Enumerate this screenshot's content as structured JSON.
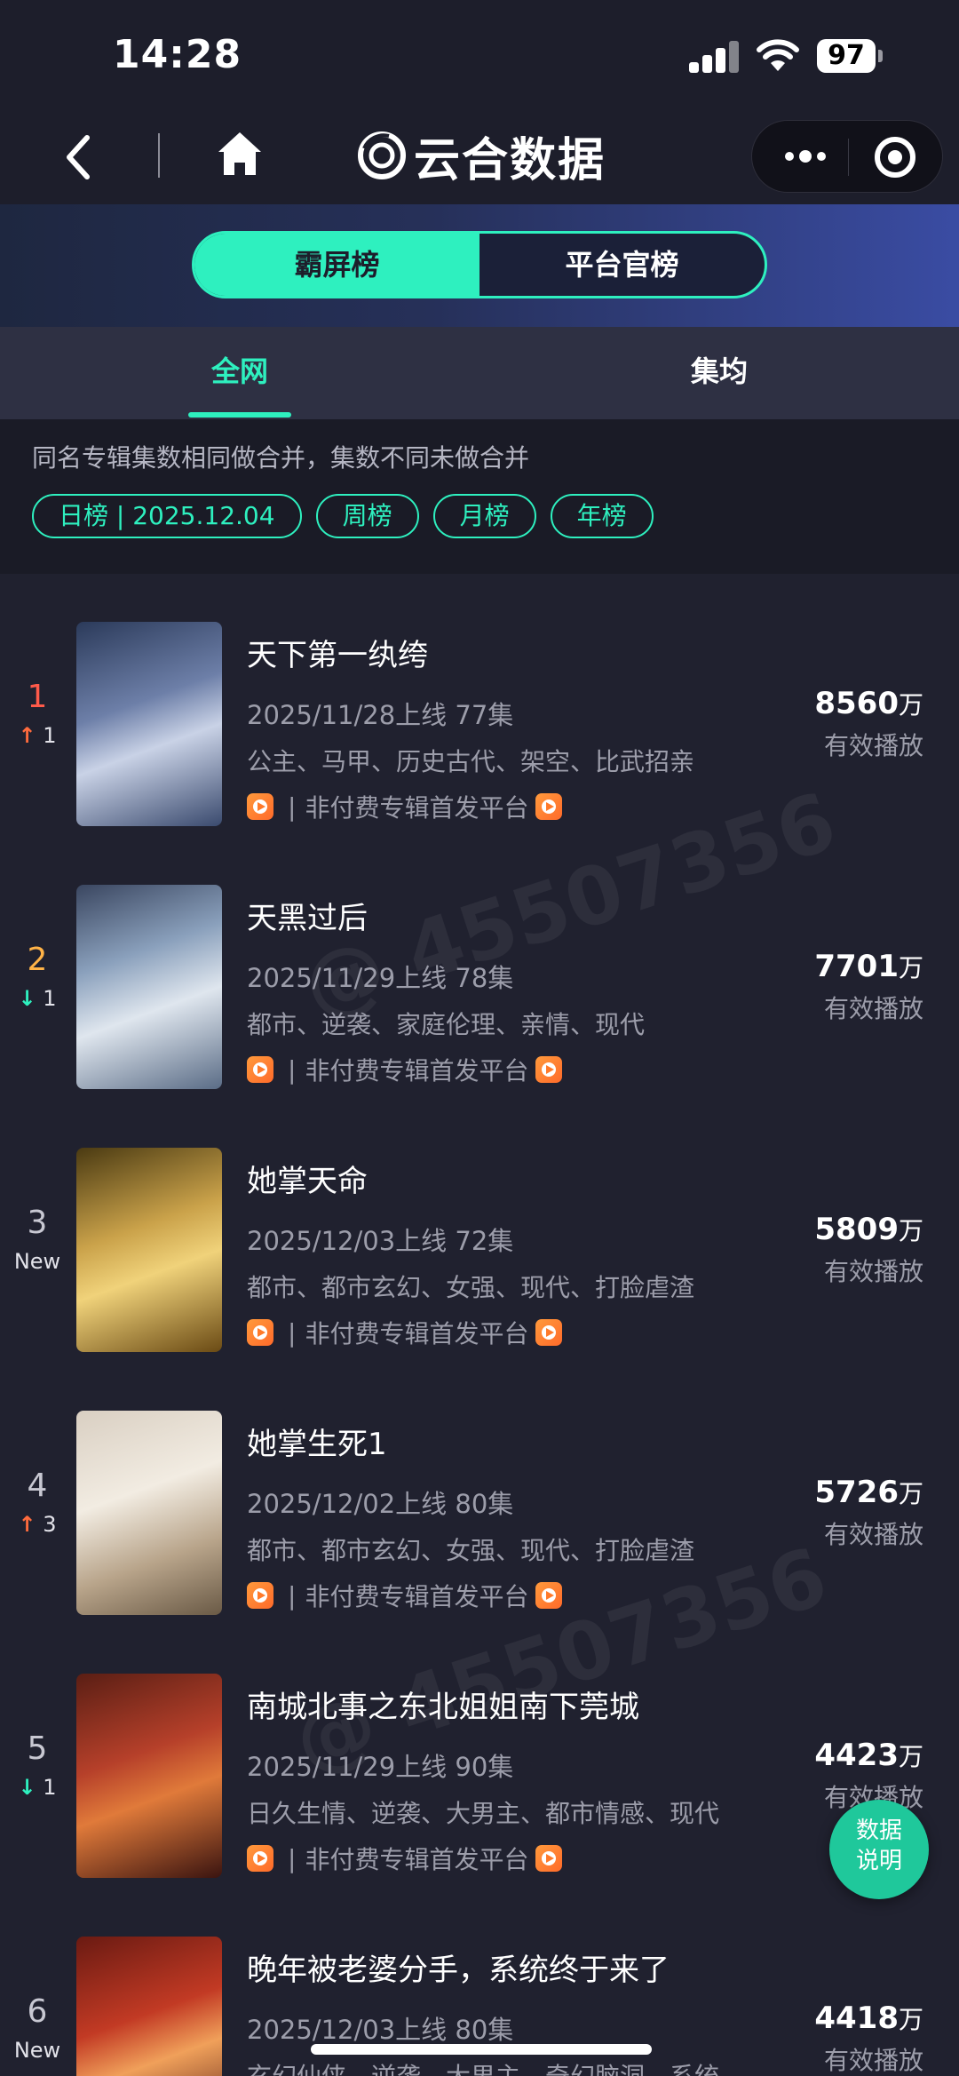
{
  "status_bar": {
    "time": "14:28",
    "battery": "97"
  },
  "nav": {
    "brand": "云合数据"
  },
  "toggle": {
    "left": "霸屏榜",
    "right": "平台官榜"
  },
  "tabs": {
    "all": "全网",
    "avg": "集均"
  },
  "filter": {
    "note": "同名专辑集数相同做合并，集数不同未做合并",
    "chips": [
      "日榜 | 2025.12.04",
      "周榜",
      "月榜",
      "年榜"
    ]
  },
  "list": {
    "unit": "万",
    "plays_label": "有效播放",
    "platform_label": "非付费专辑首发平台",
    "items": [
      {
        "rank": "1",
        "change": "1",
        "direction": "up",
        "title": "天下第一纨绔",
        "meta": "2025/11/28上线 77集",
        "tags": "公主、马甲、历史古代、架空、比武招亲",
        "plays": "8560"
      },
      {
        "rank": "2",
        "change": "1",
        "direction": "down",
        "title": "天黑过后",
        "meta": "2025/11/29上线 78集",
        "tags": "都市、逆袭、家庭伦理、亲情、现代",
        "plays": "7701"
      },
      {
        "rank": "3",
        "change": "New",
        "direction": "new",
        "title": "她掌天命",
        "meta": "2025/12/03上线 72集",
        "tags": "都市、都市玄幻、女强、现代、打脸虐渣",
        "plays": "5809"
      },
      {
        "rank": "4",
        "change": "3",
        "direction": "up",
        "title": "她掌生死1",
        "meta": "2025/12/02上线 80集",
        "tags": "都市、都市玄幻、女强、现代、打脸虐渣",
        "plays": "5726"
      },
      {
        "rank": "5",
        "change": "1",
        "direction": "down",
        "title": "南城北事之东北姐姐南下莞城",
        "meta": "2025/11/29上线 90集",
        "tags": "日久生情、逆袭、大男主、都市情感、现代",
        "plays": "4423"
      },
      {
        "rank": "6",
        "change": "New",
        "direction": "new",
        "title": "晚年被老婆分手，系统终于来了",
        "meta": "2025/12/03上线 80集",
        "tags": "玄幻仙侠、逆袭、大男主、奇幻脑洞、系统",
        "plays": "4418"
      }
    ]
  },
  "float_button": {
    "line1": "数据",
    "line2": "说明"
  },
  "colors": {
    "accent": "#2ef0bf",
    "up": "#ff6b3d",
    "rank1": "#ff5a4a",
    "rank2": "#ffb347",
    "rank_other": "#c8c8d2"
  }
}
